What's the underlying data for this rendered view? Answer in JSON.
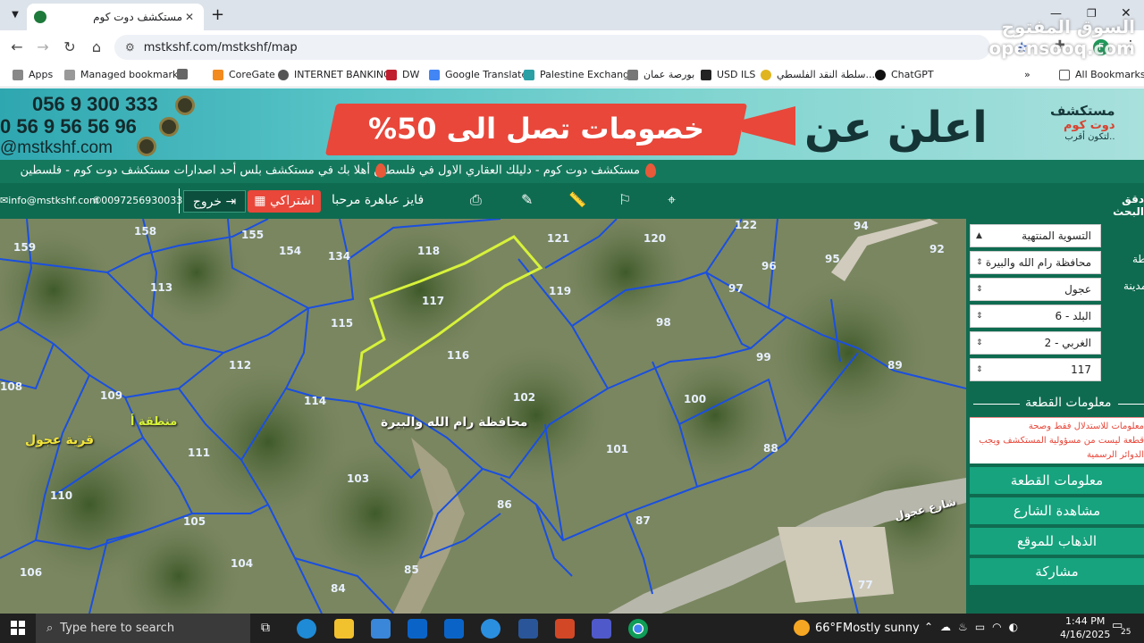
{
  "browser": {
    "tab_title": "مستكشف دوت كوم",
    "url": "mstkshf.com/mstkshf/map",
    "profile_initial": "F",
    "watermark": "السوق المفتوح opensooq.com"
  },
  "bookmarks": [
    {
      "label": "Apps",
      "icon": "apps-grid-icon"
    },
    {
      "label": "Managed bookmarks",
      "icon": "managed-bookmarks-icon"
    },
    {
      "label": "CoreGate",
      "icon": "coregate-icon"
    },
    {
      "label": "INTERNET BANKING",
      "icon": "globe-icon"
    },
    {
      "label": "DW",
      "icon": "dw-icon"
    },
    {
      "label": "Google Translate",
      "icon": "translate-icon"
    },
    {
      "label": "Palestine Exchange",
      "icon": "exchange-icon"
    },
    {
      "label": "بورصة عمان",
      "icon": "amman-bourse-icon"
    },
    {
      "label": "USD ILS",
      "icon": "inv-icon"
    },
    {
      "label": "سلطة النقد الفلسطي...",
      "icon": "pma-icon"
    },
    {
      "label": "ChatGPT",
      "icon": "chatgpt-icon"
    }
  ],
  "all_bookmarks": "All Bookmarks",
  "banner": {
    "phone1": "056 9 300 333",
    "phone2": "0 56 9 56 56 96",
    "site": "@mstkshf.com",
    "promo": "خصومات تصل الى 50%",
    "headline": "اعلن عن",
    "logo_line1": "مستكشف",
    "logo_line2": "دوت كوم",
    "logo_line3": "لتكون أقرب.."
  },
  "ticker": {
    "item1": "مستكشف دوت كوم - دليلك العقاري الاول في فلسطين",
    "item2": "أهلا بك في مستكشف بلس أحد اصدارات مستكشف دوت كوم - فلسطين"
  },
  "topnav": {
    "email": "info@mstkshf.com",
    "phone": "00972569300333",
    "logout": "خروج",
    "subscription": "اشتراكي",
    "welcome": "فايز عباهرة مرحبا",
    "search_label": "دقق البحث"
  },
  "panel": {
    "selects": [
      "التسوية المنتهية",
      "محافظة رام الله والبيرة",
      "عجول",
      "البلد - 6",
      "الغربي - 2",
      "117"
    ],
    "side_labels": [
      "طة",
      "المدينة"
    ],
    "section_title": "معلومات القطعة",
    "disclaimer": [
      "معلومات للاستدلال فقط وصحة",
      "قطعة ليست من مسؤولية المستكشف ويجب",
      "الدوائر الرسمية"
    ],
    "buttons": [
      "معلومات القطعة",
      "مشاهدة الشارع",
      "الذهاب للموقع",
      "مشاركة"
    ]
  },
  "map": {
    "governorate_label": "محافظة رام الله والبيرة",
    "village_label": "قرية عجول",
    "area_label": "منطقة أ",
    "street_label": "شارع عجول",
    "parcels": [
      "159",
      "158",
      "155",
      "154",
      "134",
      "118",
      "121",
      "120",
      "122",
      "94",
      "92",
      "113",
      "117",
      "119",
      "96",
      "95",
      "115",
      "97",
      "98",
      "116",
      "112",
      "108",
      "109",
      "114",
      "102",
      "100",
      "99",
      "89",
      "111",
      "88",
      "101",
      "110",
      "103",
      "105",
      "86",
      "87",
      "106",
      "104",
      "84",
      "85",
      "77"
    ]
  },
  "taskbar": {
    "search_placeholder": "Type here to search",
    "weather_temp": "66°F",
    "weather_text": "Mostly sunny",
    "time": "1:44 PM",
    "date": "4/16/2025",
    "notifications": "25"
  },
  "colors": {
    "accent_green": "#0f6b50",
    "button_green": "#16a37e",
    "promo_red": "#e8473a",
    "selected_parcel": "#d7f23a",
    "parcel_border": "#1a4fe0"
  }
}
